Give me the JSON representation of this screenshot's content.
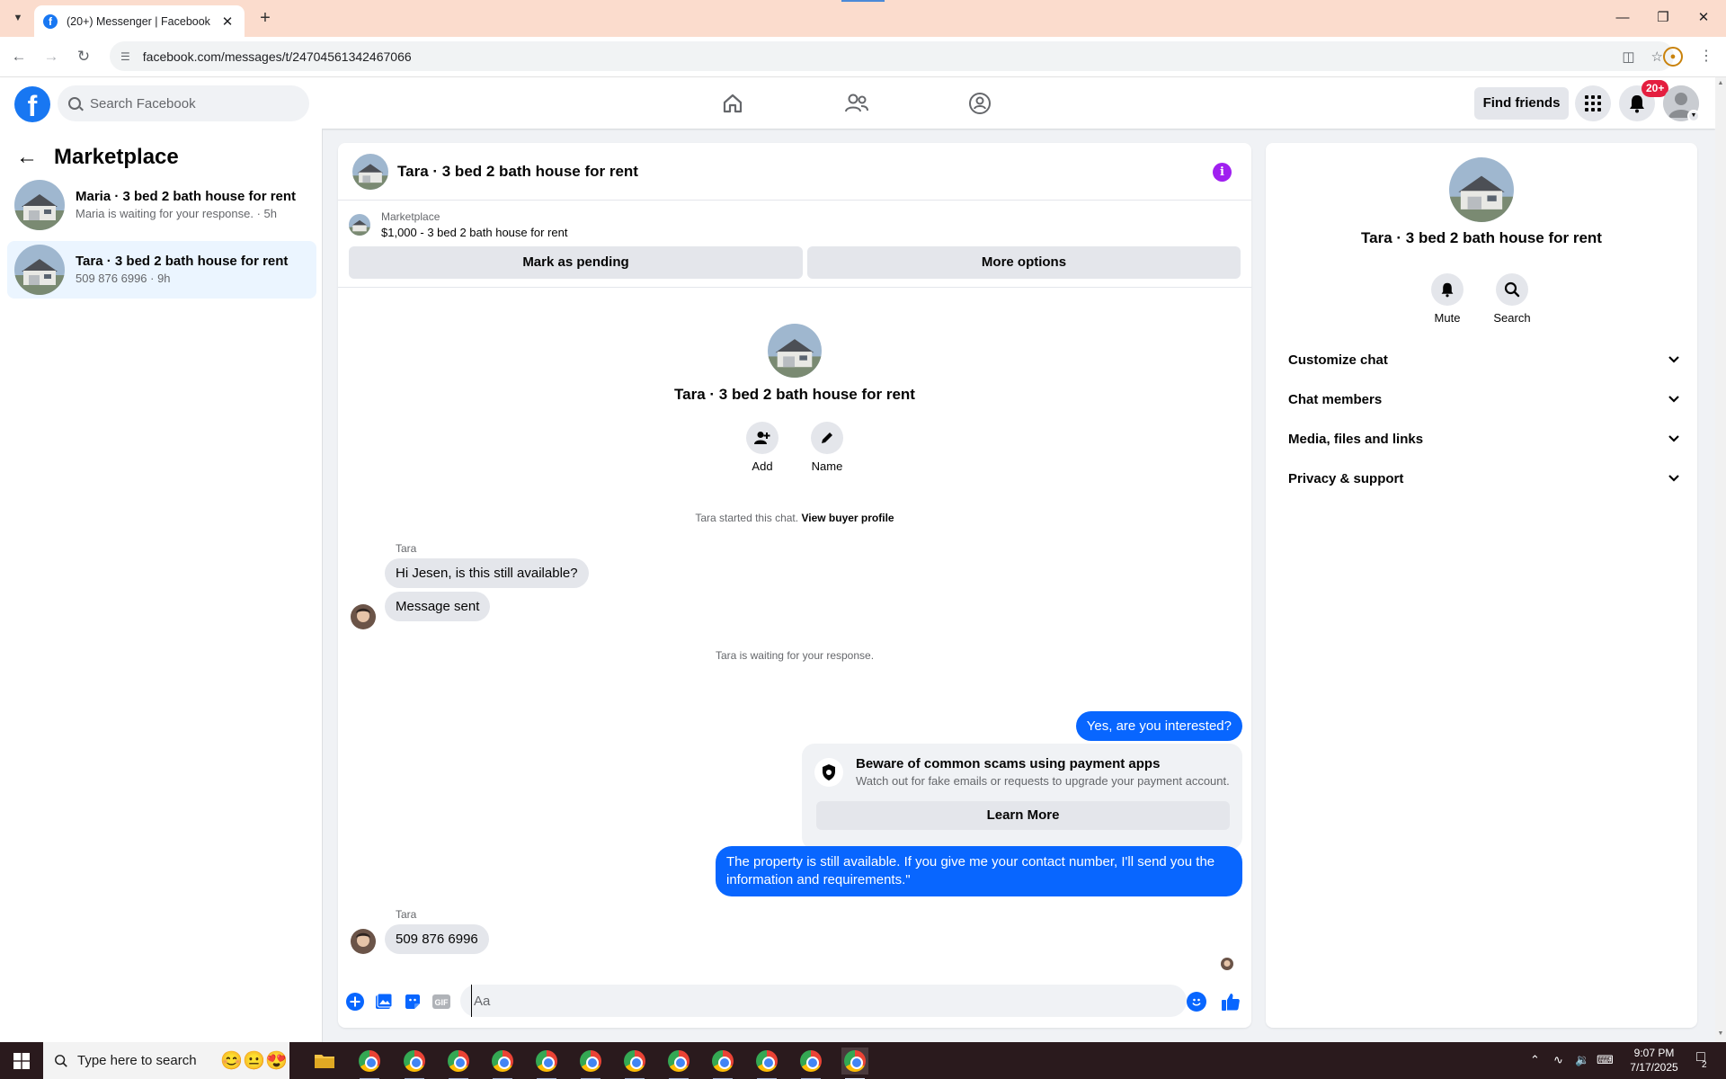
{
  "browser": {
    "tab_title": "(20+) Messenger | Facebook",
    "url": "facebook.com/messages/t/24704561342467066"
  },
  "header": {
    "search_placeholder": "Search Facebook",
    "find_friends": "Find friends",
    "notification_count": "20+"
  },
  "sidebar": {
    "title": "Marketplace",
    "conversations": [
      {
        "name": "Maria · 3 bed 2 bath house for rent",
        "preview": "Maria is waiting for your response. · 5h",
        "active": false
      },
      {
        "name": "Tara · 3 bed 2 bath house for rent",
        "preview": "509 876 6996 · 9h",
        "active": true
      }
    ]
  },
  "chat": {
    "title": "Tara · 3 bed 2 bath house for rent",
    "listing": {
      "source": "Marketplace",
      "price_title": "$1,000 - 3 bed 2 bath house for rent",
      "mark_pending": "Mark as pending",
      "more_options": "More options"
    },
    "intro": {
      "title": "Tara · 3 bed 2 bath house for rent",
      "add_label": "Add",
      "name_label": "Name"
    },
    "started_text": "Tara started this chat.",
    "view_buyer_profile": "View buyer profile",
    "sender_name_1": "Tara",
    "msg_in_1": "Hi Jesen, is this still available?",
    "msg_in_2": "Message sent",
    "waiting_text": "Tara is waiting for your response.",
    "msg_out_1": "Yes, are you interested?",
    "scam": {
      "title": "Beware of common scams using payment apps",
      "desc": "Watch out for fake emails or requests to upgrade your payment account.",
      "button": "Learn More"
    },
    "msg_out_2": "The property is still available. If you give me your contact number, I'll send you the information and requirements.\"",
    "sender_name_2": "Tara",
    "msg_in_3": "509 876 6996",
    "composer_placeholder": "Aa"
  },
  "info_panel": {
    "title": "Tara · 3 bed 2 bath house for rent",
    "mute_label": "Mute",
    "search_label": "Search",
    "sections": [
      "Customize chat",
      "Chat members",
      "Media, files and links",
      "Privacy & support"
    ]
  },
  "taskbar": {
    "search_placeholder": "Type here to search",
    "time": "9:07 PM",
    "date": "7/17/2025",
    "notification_count": "2"
  },
  "colors": {
    "facebook_blue": "#1877f2",
    "messenger_bubble_out": "#0866ff",
    "bubble_in": "#e4e6eb",
    "info_button": "#a020f0",
    "notification_badge": "#e41e3f",
    "tab_strip": "#fbdccd"
  }
}
